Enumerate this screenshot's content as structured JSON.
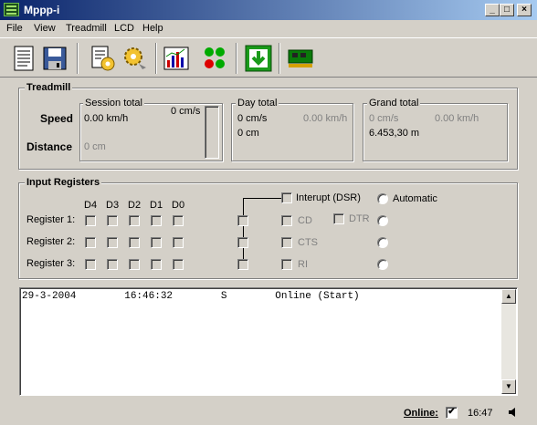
{
  "window": {
    "title": "Mppp-i",
    "min": "_",
    "max": "□",
    "close": "×"
  },
  "menu": {
    "file": "File",
    "view": "View",
    "treadmill": "Treadmill",
    "lcd": "LCD",
    "help": "Help"
  },
  "toolbar": {
    "icons": [
      "report-icon",
      "save-icon",
      "settings-doc-icon",
      "gear-icon",
      "chart-icon",
      "lights-icon",
      "download-icon",
      "circuit-board-icon"
    ]
  },
  "treadmill": {
    "title": "Treadmill",
    "speed_label": "Speed",
    "distance_label": "Distance",
    "session": {
      "title": "Session total",
      "speed_cms": "0 cm/s",
      "speed_kmh": "0.00 km/h",
      "distance": "0 cm"
    },
    "day": {
      "title": "Day total",
      "speed_cms": "0 cm/s",
      "speed_kmh": "0.00 km/h",
      "distance": "0 cm"
    },
    "grand": {
      "title": "Grand total",
      "speed_cms": "0 cm/s",
      "speed_kmh": "0.00 km/h",
      "distance": "6.453,30 m"
    }
  },
  "input_registers": {
    "title": "Input Registers",
    "bits": [
      "D4",
      "D3",
      "D2",
      "D1",
      "D0"
    ],
    "registers": [
      "Register 1:",
      "Register 2:",
      "Register 3:"
    ],
    "interrupt": "Interupt (DSR)",
    "automatic": "Automatic",
    "cd": "CD",
    "dtr": "DTR",
    "cts": "CTS",
    "ri": "RI"
  },
  "log": {
    "lines": [
      "29-3-2004        16:46:32        S        Online (Start)"
    ]
  },
  "status": {
    "online_label": "Online:",
    "online_checked": true,
    "time": "16:47"
  }
}
